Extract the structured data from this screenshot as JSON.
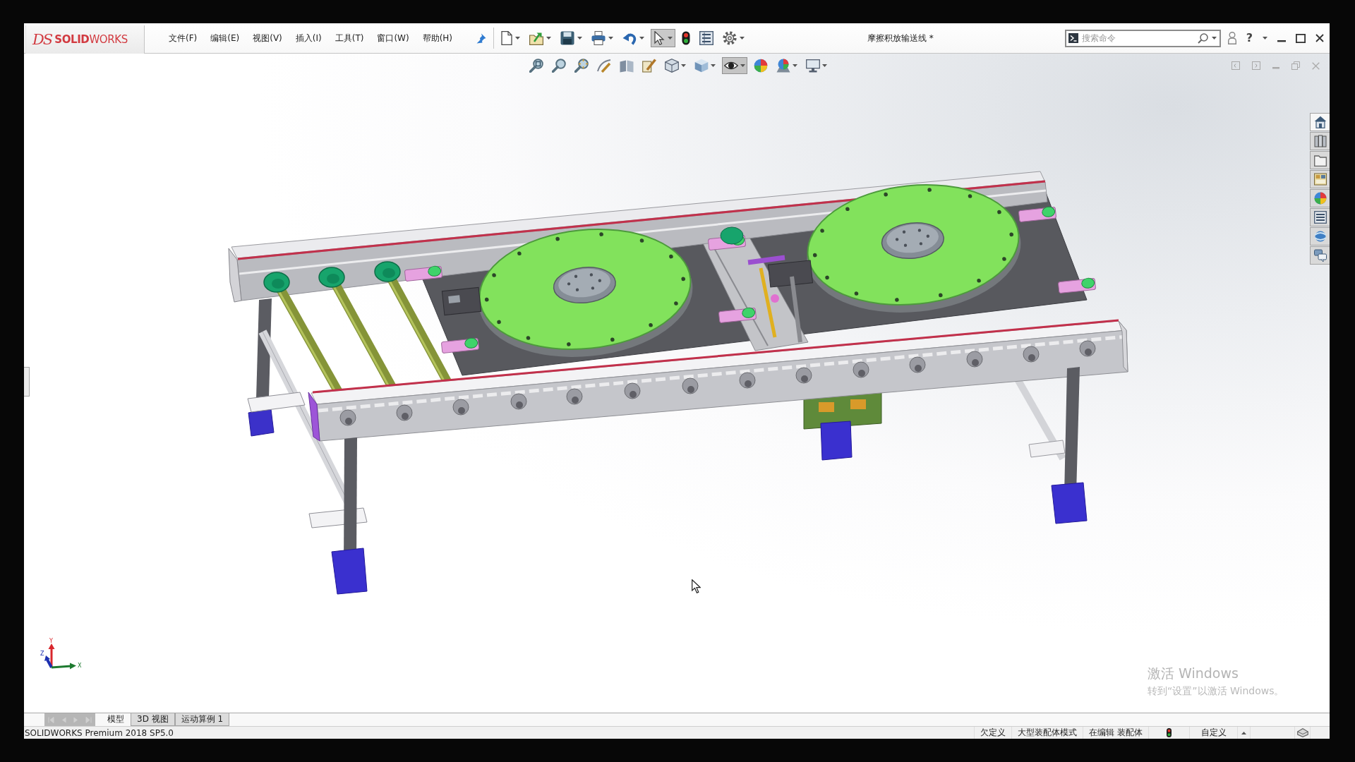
{
  "window": {
    "title": "摩擦积放输送线 *",
    "help": "?"
  },
  "logo": {
    "mark": "DS",
    "name": "**SOLID**WORKS"
  },
  "menu": [
    "文件(F)",
    "编辑(E)",
    "视图(V)",
    "插入(I)",
    "工具(T)",
    "窗口(W)",
    "帮助(H)"
  ],
  "toolbar": [
    {
      "pressed": false,
      "dropdown": true
    },
    {
      "pressed": false,
      "dropdown": true
    },
    {
      "pressed": false,
      "dropdown": true
    },
    {
      "pressed": false,
      "dropdown": true
    },
    {
      "pressed": false,
      "dropdown": true
    },
    {
      "pressed": true,
      "dropdown": true
    },
    {
      "pressed": false,
      "dropdown": false
    },
    {
      "pressed": false,
      "dropdown": false
    },
    {
      "pressed": false,
      "dropdown": true
    }
  ],
  "search": {
    "placeholder": "搜索命令"
  },
  "view_toolbar": [
    {
      "pressed": false,
      "dropdown": false
    },
    {
      "pressed": false,
      "dropdown": false
    },
    {
      "pressed": false,
      "dropdown": false
    },
    {
      "pressed": false,
      "dropdown": false
    },
    {
      "pressed": false,
      "dropdown": false
    },
    {
      "pressed": false,
      "dropdown": false
    },
    {
      "pressed": false,
      "dropdown": true
    },
    {
      "pressed": false,
      "dropdown": true
    },
    {
      "pressed": true,
      "dropdown": true
    },
    {
      "pressed": false,
      "dropdown": false
    },
    {
      "pressed": false,
      "dropdown": true
    },
    {
      "pressed": false,
      "dropdown": true
    }
  ],
  "task_pane_tabs": [
    {
      "selected": true
    },
    {
      "selected": false
    },
    {
      "selected": false
    },
    {
      "selected": false
    },
    {
      "selected": false
    },
    {
      "selected": false
    },
    {
      "selected": false
    },
    {
      "selected": false
    }
  ],
  "triad": {
    "x": "X",
    "y": "Y",
    "z": "Z"
  },
  "activation_notice": {
    "title": "激活 Windows",
    "hint": "转到“设置”以激活 Windows。"
  },
  "document_tabs": [
    {
      "label": "模型",
      "selected": true
    },
    {
      "label": "3D 视图",
      "selected": false
    },
    {
      "label": "运动算例 1",
      "selected": false
    }
  ],
  "status_bar": {
    "version": "SOLIDWORKS Premium 2018 SP5.0",
    "items": [
      "欠定义",
      "大型装配体模式",
      "在编辑 装配体"
    ],
    "units": "自定义"
  }
}
